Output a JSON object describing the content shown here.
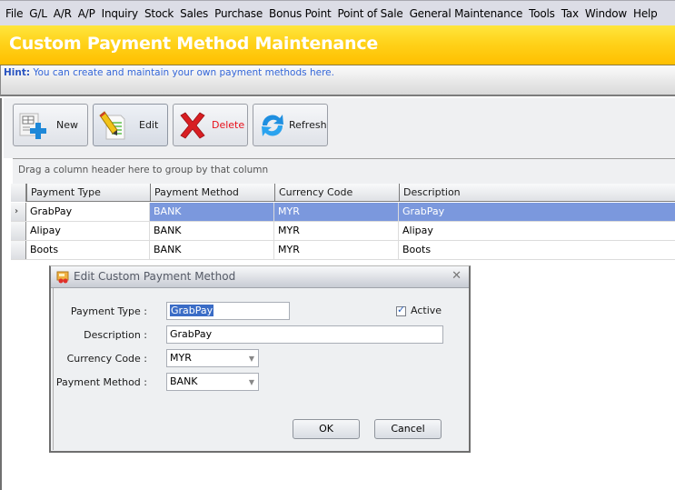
{
  "menu": [
    "File",
    "G/L",
    "A/R",
    "A/P",
    "Inquiry",
    "Stock",
    "Sales",
    "Purchase",
    "Bonus Point",
    "Point of Sale",
    "General Maintenance",
    "Tools",
    "Tax",
    "Window",
    "Help"
  ],
  "banner": {
    "title": "Custom Payment Method Maintenance"
  },
  "hint": {
    "label": "Hint:",
    "text": "You can create and maintain your own payment methods here."
  },
  "toolbar": {
    "new_label": "New",
    "edit_label": "Edit",
    "delete_label": "Delete",
    "refresh_label": "Refresh"
  },
  "grid": {
    "group_hint": "Drag a column header here to group by that column",
    "columns": [
      "Payment Type",
      "Payment Method",
      "Currency Code",
      "Description"
    ],
    "rows": [
      {
        "payment_type": "GrabPay",
        "payment_method": "BANK",
        "currency_code": "MYR",
        "description": "GrabPay",
        "selected": true
      },
      {
        "payment_type": "Alipay",
        "payment_method": "BANK",
        "currency_code": "MYR",
        "description": "Alipay",
        "selected": false
      },
      {
        "payment_type": "Boots",
        "payment_method": "BANK",
        "currency_code": "MYR",
        "description": "Boots",
        "selected": false
      }
    ],
    "selected_color": "#7b98dd"
  },
  "dialog": {
    "title": "Edit Custom Payment Method",
    "close_glyph": "✕",
    "fields": {
      "payment_type_label": "Payment Type :",
      "payment_type_value": "GrabPay",
      "description_label": "Description :",
      "description_value": "GrabPay",
      "currency_code_label": "Currency Code :",
      "currency_code_value": "MYR",
      "payment_method_label": "Payment Method :",
      "payment_method_value": "BANK"
    },
    "active_label": "Active",
    "active_checked": true,
    "ok_label": "OK",
    "cancel_label": "Cancel"
  },
  "colors": {
    "banner_yellow": "#ffd21a",
    "hint_blue": "#3466d8",
    "delete_red": "#e8101a"
  }
}
